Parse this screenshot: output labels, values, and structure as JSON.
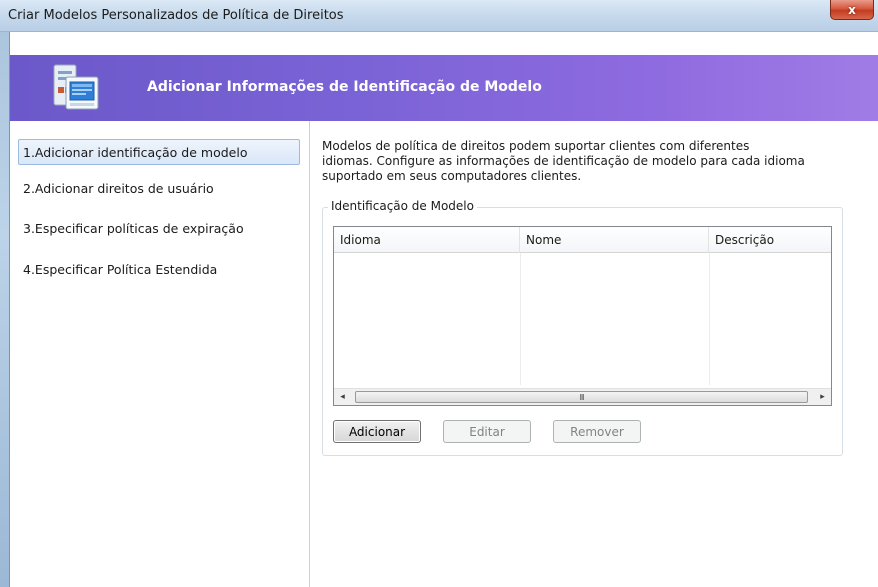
{
  "window": {
    "title": "Criar Modelos Personalizados de Política de Direitos",
    "close_label": "x"
  },
  "header": {
    "title": "Adicionar Informações de Identificação de Modelo",
    "icon": "document-template-icon",
    "gradient_colors": [
      "#6b58c9",
      "#a07ce6"
    ]
  },
  "nav": {
    "items": [
      {
        "label": "1.Adicionar identificação de modelo",
        "selected": true
      },
      {
        "label": "2.Adicionar direitos de usuário",
        "selected": false
      },
      {
        "label": "3.Especificar políticas de expiração",
        "selected": false
      },
      {
        "label": "4.Especificar Política Estendida",
        "selected": false
      }
    ]
  },
  "main": {
    "description_lines": [
      "Modelos de política de direitos podem suportar clientes com diferentes",
      "idiomas. Configure as informações de identificação de modelo para cada idioma",
      "suportado em seus computadores clientes."
    ],
    "group_label": "Identificação de Modelo",
    "table": {
      "columns": [
        "Idioma",
        "Nome",
        "Descrição"
      ],
      "rows": []
    },
    "scrollbar": {
      "left_arrow": "◂",
      "right_arrow": "▸",
      "grip": "III"
    },
    "buttons": {
      "add": "Adicionar",
      "edit": "Editar",
      "remove": "Remover"
    }
  }
}
